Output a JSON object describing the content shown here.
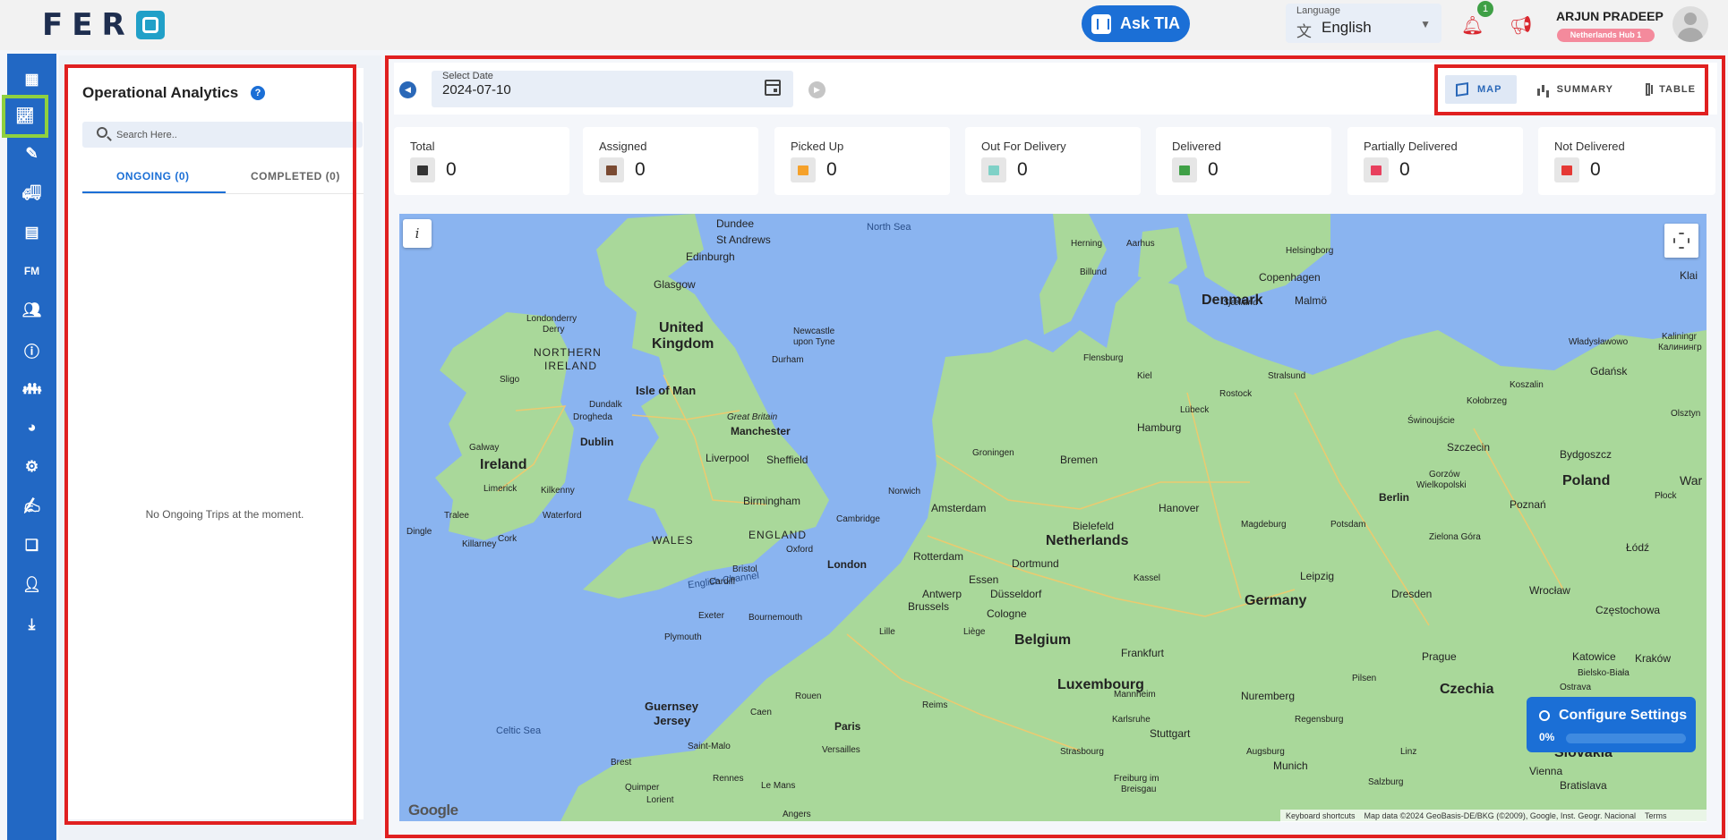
{
  "app": {
    "logo_text": "FER"
  },
  "header": {
    "ask_tia": "Ask TIA",
    "language_label": "Language",
    "language_value": "English",
    "notification_count": "1",
    "user_name": "ARJUN PRADEEP",
    "user_hub": "Netherlands Hub 1"
  },
  "nav": {
    "fm_label": "FM",
    "icons": [
      "dashboard-icon",
      "analytics-icon",
      "planner-icon",
      "truck-icon",
      "inventory-icon",
      "fm-icon",
      "users-icon",
      "info-icon",
      "team-icon",
      "palette-icon",
      "settings-icon",
      "edit-icon",
      "documents-icon",
      "admin-icon",
      "download-icon"
    ]
  },
  "left_panel": {
    "title": "Operational Analytics",
    "search_placeholder": "Search Here..",
    "tabs": [
      {
        "label": "ONGOING (0)",
        "active": true
      },
      {
        "label": "COMPLETED (0)",
        "active": false
      }
    ],
    "empty_message": "No Ongoing Trips at the moment."
  },
  "date_picker": {
    "label": "Select Date",
    "value": "2024-07-10"
  },
  "view_toggle": [
    {
      "label": "MAP",
      "active": true
    },
    {
      "label": "SUMMARY",
      "active": false
    },
    {
      "label": "TABLE",
      "active": false
    }
  ],
  "stats": [
    {
      "label": "Total",
      "value": "0",
      "color": "#333333"
    },
    {
      "label": "Assigned",
      "value": "0",
      "color": "#7a4a32"
    },
    {
      "label": "Picked Up",
      "value": "0",
      "color": "#f5a12a"
    },
    {
      "label": "Out For Delivery",
      "value": "0",
      "color": "#7fd1c7"
    },
    {
      "label": "Delivered",
      "value": "0",
      "color": "#3fa046"
    },
    {
      "label": "Partially Delivered",
      "value": "0",
      "color": "#e8405e"
    },
    {
      "label": "Not Delivered",
      "value": "0",
      "color": "#e53935"
    }
  ],
  "map": {
    "info_label": "i",
    "google": "Google",
    "attribution": [
      "Keyboard shortcuts",
      "Map data ©2024 GeoBasis-DE/BKG (©2009), Google, Inst. Geogr. Nacional",
      "Terms"
    ],
    "labels": {
      "north_sea": "North Sea",
      "english_channel": "English Channel",
      "celtic_sea": "Celtic Sea",
      "uk": "United",
      "uk2": "Kingdom",
      "ireland": "Ireland",
      "northern_ireland": "NORTHERN",
      "northern_ireland2": "IRELAND",
      "isle_of_man": "Isle of Man",
      "wales": "WALES",
      "england": "ENGLAND",
      "denmark": "Denmark",
      "netherlands": "Netherlands",
      "belgium": "Belgium",
      "luxembourg": "Luxembourg",
      "germany": "Germany",
      "poland": "Poland",
      "czechia": "Czechia",
      "slovakia": "Slovakia",
      "guernsey": "Guernsey",
      "jersey": "Jersey",
      "edinburgh": "Edinburgh",
      "glasgow": "Glasgow",
      "dundee": "Dundee",
      "st_andrews": "St Andrews",
      "newcastle": "Newcastle",
      "newcastle2": "upon Tyne",
      "durham": "Durham",
      "londonderry": "Londonderry",
      "derry": "Derry",
      "sligo": "Sligo",
      "dundalk": "Dundalk",
      "drogheda": "Drogheda",
      "dublin": "Dublin",
      "galway": "Galway",
      "limerick": "Limerick",
      "kilkenny": "Kilkenny",
      "waterford": "Waterford",
      "tralee": "Tralee",
      "killarney": "Killarney",
      "cork": "Cork",
      "dingle": "Dingle",
      "great_britain": "Great Britain",
      "manchester": "Manchester",
      "liverpool": "Liverpool",
      "sheffield": "Sheffield",
      "birmingham": "Birmingham",
      "norwich": "Norwich",
      "cambridge": "Cambridge",
      "oxford": "Oxford",
      "london": "London",
      "bristol": "Bristol",
      "cardiff": "Cardiff",
      "exeter": "Exeter",
      "bournemouth": "Bournemouth",
      "plymouth": "Plymouth",
      "herning": "Herning",
      "aarhus": "Aarhus",
      "helsingborg": "Helsingborg",
      "billund": "Billund",
      "copenhagen": "Copenhagen",
      "sjaelland": "Sjælland",
      "malmo": "Malmö",
      "flensburg": "Flensburg",
      "kiel": "Kiel",
      "stralsund": "Stralsund",
      "rostock": "Rostock",
      "lubeck": "Lübeck",
      "hamburg": "Hamburg",
      "groningen": "Groningen",
      "bremen": "Bremen",
      "amsterdam": "Amsterdam",
      "hanover": "Hanover",
      "bielefeld": "Bielefeld",
      "magdeburg": "Magdeburg",
      "potsdam": "Potsdam",
      "berlin": "Berlin",
      "rotterdam": "Rotterdam",
      "dortmund": "Dortmund",
      "essen": "Essen",
      "antwerp": "Antwerp",
      "dusseldorf": "Düsseldorf",
      "kassel": "Kassel",
      "leipzig": "Leipzig",
      "dresden": "Dresden",
      "brussels": "Brussels",
      "cologne": "Cologne",
      "lille": "Lille",
      "liege": "Liège",
      "frankfurt": "Frankfurt",
      "gdansk": "Gdańsk",
      "koszalin": "Koszalin",
      "kolobrzeg": "Kołobrzeg",
      "olsztyn": "Olsztyn",
      "swinoujscie": "Świnoujście",
      "szczecin": "Szczecin",
      "bydgoszcz": "Bydgoszcz",
      "gorzow": "Gorzów",
      "gorzow2": "Wielkopolski",
      "poznan": "Poznań",
      "plock": "Płock",
      "zielona_gora": "Zielona Góra",
      "lodz": "Łódź",
      "wroclaw": "Wrocław",
      "czestochowa": "Częstochowa",
      "prague": "Prague",
      "katowice": "Katowice",
      "krakow": "Kraków",
      "bielsko": "Bielsko-Biała",
      "ostrava": "Ostrava",
      "pilsen": "Pilsen",
      "mannheim": "Mannheim",
      "nuremberg": "Nuremberg",
      "karlsruhe": "Karlsruhe",
      "stuttgart": "Stuttgart",
      "regensburg": "Regensburg",
      "strasbourg": "Strasbourg",
      "augsburg": "Augsburg",
      "munich": "Munich",
      "freiburg": "Freiburg im",
      "freiburg2": "Breisgau",
      "salzburg": "Salzburg",
      "linz": "Linz",
      "vienna": "Vienna",
      "bratislava": "Bratislava",
      "rouen": "Rouen",
      "caen": "Caen",
      "paris": "Paris",
      "versailles": "Versailles",
      "reims": "Reims",
      "saint_malo": "Saint-Malo",
      "brest": "Brest",
      "rennes": "Rennes",
      "le_mans": "Le Mans",
      "quimper": "Quimper",
      "lorient": "Lorient",
      "angers": "Angers",
      "wladyslawowo": "Władysławowo",
      "kaliningrad": "Kaliningr",
      "kaliningrad2": "Калинингр",
      "klaipeda": "Klai",
      "warsaw": "War"
    }
  },
  "config": {
    "title": "Configure Settings",
    "percent_text": "0%",
    "progress": 0
  }
}
